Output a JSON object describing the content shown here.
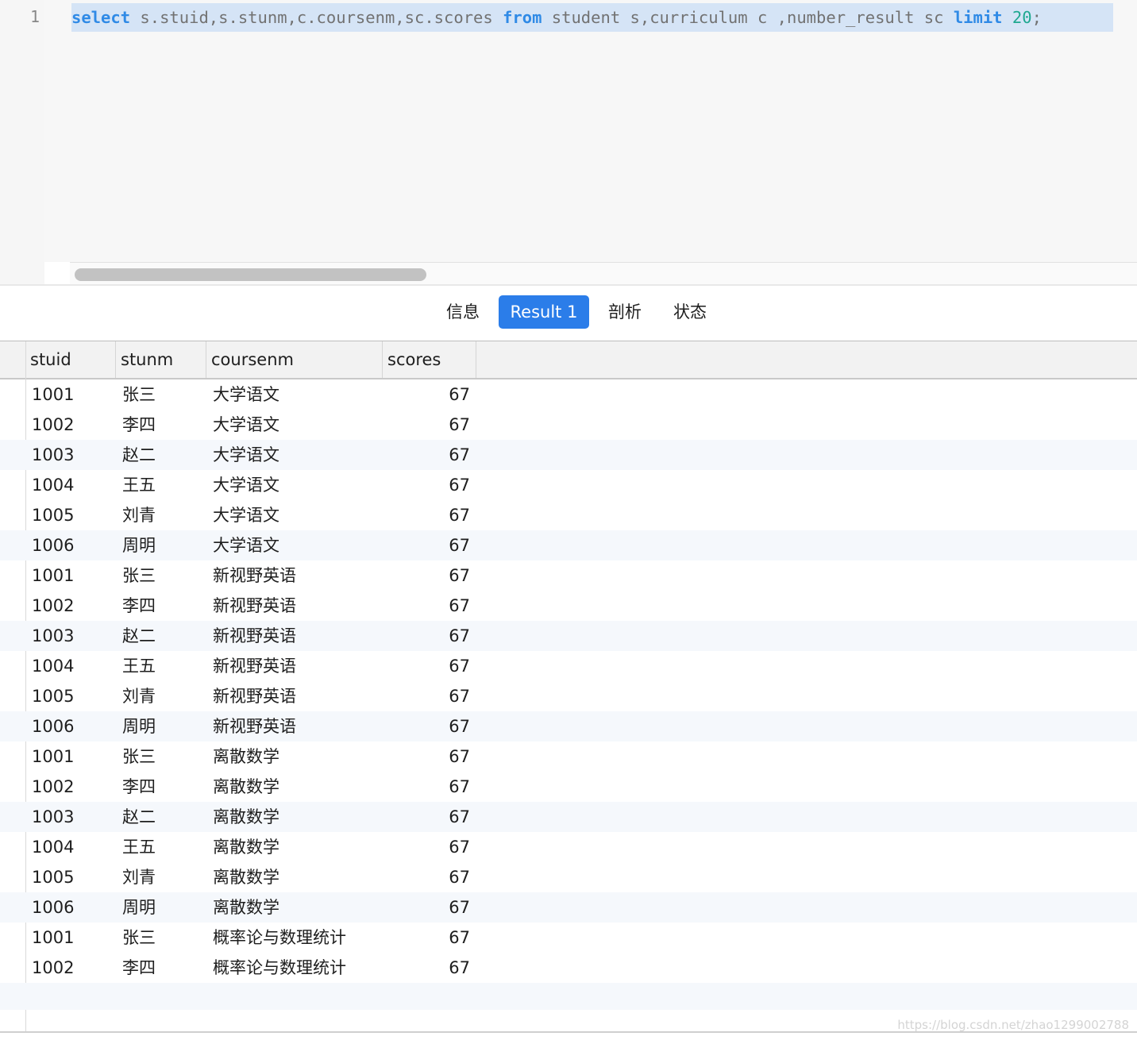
{
  "editor": {
    "line_number": "1",
    "sql_tokens": [
      {
        "text": "select",
        "type": "kw"
      },
      {
        "text": " s.stuid,s.stunm,c.coursenm,sc.scores ",
        "type": "plain"
      },
      {
        "text": "from",
        "type": "kw"
      },
      {
        "text": " student s,curriculum c ,number_result sc ",
        "type": "plain"
      },
      {
        "text": "limit",
        "type": "kw"
      },
      {
        "text": " ",
        "type": "plain"
      },
      {
        "text": "20",
        "type": "num"
      },
      {
        "text": ";",
        "type": "plain"
      }
    ]
  },
  "tabs": [
    {
      "label": "信息",
      "active": false
    },
    {
      "label": "Result 1",
      "active": true
    },
    {
      "label": "剖析",
      "active": false
    },
    {
      "label": "状态",
      "active": false
    }
  ],
  "grid": {
    "columns": [
      "stuid",
      "stunm",
      "coursenm",
      "scores"
    ],
    "rows": [
      [
        "1001",
        "张三",
        "大学语文",
        "67"
      ],
      [
        "1002",
        "李四",
        "大学语文",
        "67"
      ],
      [
        "1003",
        "赵二",
        "大学语文",
        "67"
      ],
      [
        "1004",
        "王五",
        "大学语文",
        "67"
      ],
      [
        "1005",
        "刘青",
        "大学语文",
        "67"
      ],
      [
        "1006",
        "周明",
        "大学语文",
        "67"
      ],
      [
        "1001",
        "张三",
        "新视野英语",
        "67"
      ],
      [
        "1002",
        "李四",
        "新视野英语",
        "67"
      ],
      [
        "1003",
        "赵二",
        "新视野英语",
        "67"
      ],
      [
        "1004",
        "王五",
        "新视野英语",
        "67"
      ],
      [
        "1005",
        "刘青",
        "新视野英语",
        "67"
      ],
      [
        "1006",
        "周明",
        "新视野英语",
        "67"
      ],
      [
        "1001",
        "张三",
        "离散数学",
        "67"
      ],
      [
        "1002",
        "李四",
        "离散数学",
        "67"
      ],
      [
        "1003",
        "赵二",
        "离散数学",
        "67"
      ],
      [
        "1004",
        "王五",
        "离散数学",
        "67"
      ],
      [
        "1005",
        "刘青",
        "离散数学",
        "67"
      ],
      [
        "1006",
        "周明",
        "离散数学",
        "67"
      ],
      [
        "1001",
        "张三",
        "概率论与数理统计",
        "67"
      ],
      [
        "1002",
        "李四",
        "概率论与数理统计",
        "67"
      ]
    ]
  },
  "watermark": "https://blog.csdn.net/zhao1299002788",
  "colors": {
    "keyword": "#2f8ae6",
    "number": "#1fa890",
    "selection": "#d5e4f6",
    "active_tab": "#2b7de9"
  }
}
